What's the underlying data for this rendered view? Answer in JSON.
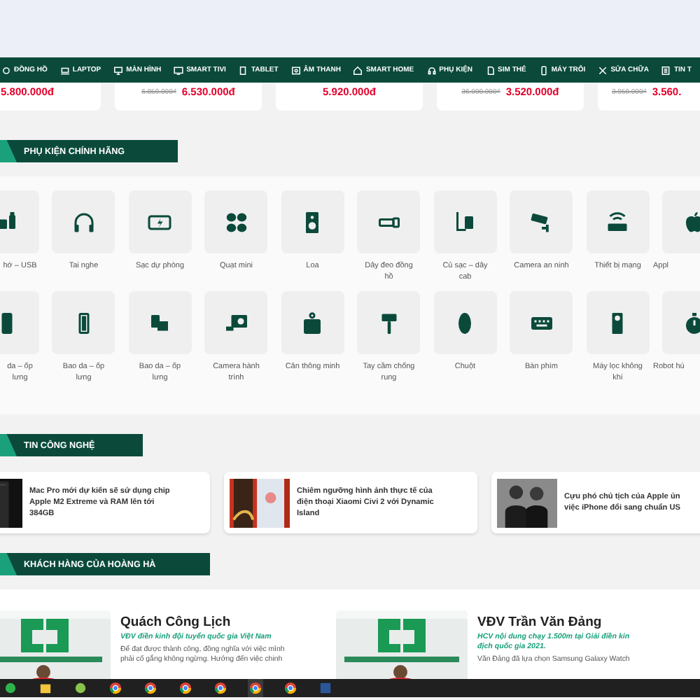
{
  "nav": [
    {
      "label": "ĐỒNG HỒ"
    },
    {
      "label": "LAPTOP"
    },
    {
      "label": "MÀN HÌNH"
    },
    {
      "label": "SMART TIVI"
    },
    {
      "label": "TABLET"
    },
    {
      "label": "ÂM THANH"
    },
    {
      "label": "SMART HOME"
    },
    {
      "label": "PHỤ KIỆN"
    },
    {
      "label": "SIM THẺ"
    },
    {
      "label": "MÁY TRÔI"
    },
    {
      "label": "SỬA CHỮA"
    },
    {
      "label": "TIN T"
    }
  ],
  "prices": [
    {
      "price": "5.800.000đ"
    },
    {
      "old_price": "6.850.000₫",
      "price": "6.530.000đ"
    },
    {
      "price": "5.920.000đ"
    },
    {
      "old_price": "36.000.000₫",
      "price": "3.520.000đ"
    },
    {
      "old_price": "3.950.000₫",
      "price": "3.560."
    }
  ],
  "accessories": {
    "title": "PHỤ KIỆN CHÍNH HÃNG",
    "items": [
      {
        "label": "hớ – USB"
      },
      {
        "label": "Tai nghe"
      },
      {
        "label": "Sạc dự phòng"
      },
      {
        "label": "Quạt mini"
      },
      {
        "label": "Loa"
      },
      {
        "label": "Dây đeo đồng hồ"
      },
      {
        "label": "Củ sạc – dây cab"
      },
      {
        "label": "Camera an ninh"
      },
      {
        "label": "Thiết bị mạng"
      },
      {
        "label": "Appl"
      },
      {
        "label": "da – ốp lưng"
      },
      {
        "label": "Bao da – ốp lưng"
      },
      {
        "label": "Bao da – ốp lưng"
      },
      {
        "label": "Camera hành trình"
      },
      {
        "label": "Cân thông minh"
      },
      {
        "label": "Tay cầm chống rung"
      },
      {
        "label": "Chuột"
      },
      {
        "label": "Bàn phím"
      },
      {
        "label": "Máy lọc không khí"
      },
      {
        "label": "Robot hú"
      }
    ]
  },
  "news": {
    "title": "TIN CÔNG NGHỆ",
    "items": [
      {
        "title_lines": [
          "Mac Pro mới dự kiến sẽ sử dụng chip",
          "Apple M2 Extreme và RAM lên tới",
          "384GB"
        ]
      },
      {
        "title_lines": [
          "Chiêm ngưỡng hình ảnh thực tế của",
          "điện thoại Xiaomi Civi 2 với Dynamic",
          "Island"
        ]
      },
      {
        "title_lines": [
          "Cựu phó chủ tịch của Apple ủn",
          "việc iPhone đổi sang chuẩn US"
        ]
      }
    ]
  },
  "customers": {
    "title": "KHÁCH HÀNG CỦA HOÀNG HÀ",
    "items": [
      {
        "name": "Quách Công Lịch",
        "subtitle_lines": [
          "VĐV điền kinh đội tuyển quốc gia Việt Nam"
        ],
        "text_lines": [
          "Để đạt được thành công, đồng nghĩa với việc mình",
          "phải cố gắng không ngừng. Hướng đến việc chinh"
        ]
      },
      {
        "name": "VĐV Trần Văn Đảng",
        "subtitle_lines": [
          "HCV nội dung chạy 1.500m tại Giải điền kin",
          "địch quốc gia 2021."
        ],
        "text_lines": [
          "Văn Đảng đã lựa chọn Samsung Galaxy Watch"
        ]
      }
    ]
  }
}
